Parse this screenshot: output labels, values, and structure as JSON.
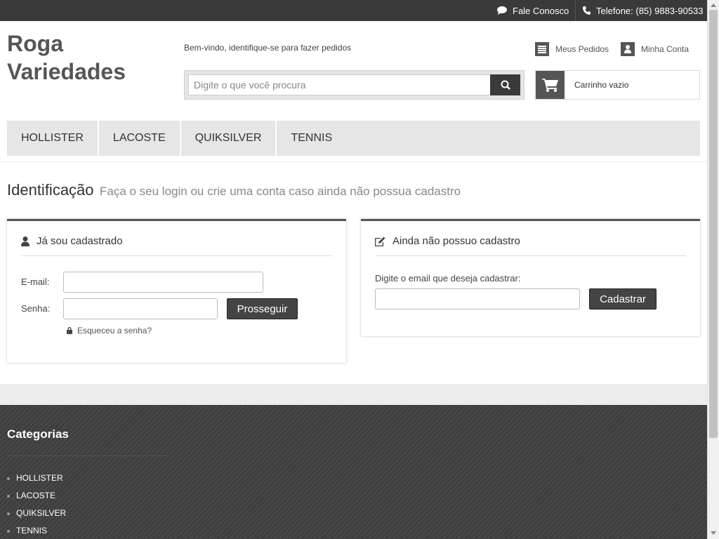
{
  "topbar": {
    "contact_label": "Fale Conosco",
    "phone_label": "Telefone: (85) 9883-90533"
  },
  "header": {
    "logo_line1": "Roga",
    "logo_line2": "Variedades",
    "welcome": "Bem-vindo, identifique-se para fazer pedidos",
    "my_orders": "Meus Pedidos",
    "my_account": "Minha Conta",
    "search_placeholder": "Digite o que você procura",
    "cart_label": "Carrinho vazio"
  },
  "nav": {
    "items": [
      {
        "label": "HOLLISTER"
      },
      {
        "label": "LACOSTE"
      },
      {
        "label": "QUIKSILVER"
      },
      {
        "label": "TENNIS"
      }
    ]
  },
  "identification": {
    "title": "Identificação",
    "subtitle": "Faça o seu login ou crie uma conta caso ainda não possua cadastro"
  },
  "login": {
    "heading": "Já sou cadastrado",
    "email_label": "E-mail:",
    "password_label": "Senha:",
    "submit_label": "Prosseguir",
    "forgot_label": "Esqueceu a senha?"
  },
  "register": {
    "heading": "Ainda não possuo cadastro",
    "email_label": "Digite o email que deseja cadastrar:",
    "submit_label": "Cadastrar"
  },
  "footer": {
    "title": "Categorias",
    "items": [
      {
        "label": "HOLLISTER"
      },
      {
        "label": "LACOSTE"
      },
      {
        "label": "QUIKSILVER"
      },
      {
        "label": "TENNIS"
      }
    ]
  },
  "icons": {
    "contact": "chat-bubble-icon",
    "phone": "phone-icon",
    "orders": "list-icon",
    "account": "user-icon",
    "search": "search-icon",
    "cart": "shopping-cart-icon",
    "login": "user-icon",
    "register": "edit-icon",
    "forgot": "lock-icon"
  }
}
